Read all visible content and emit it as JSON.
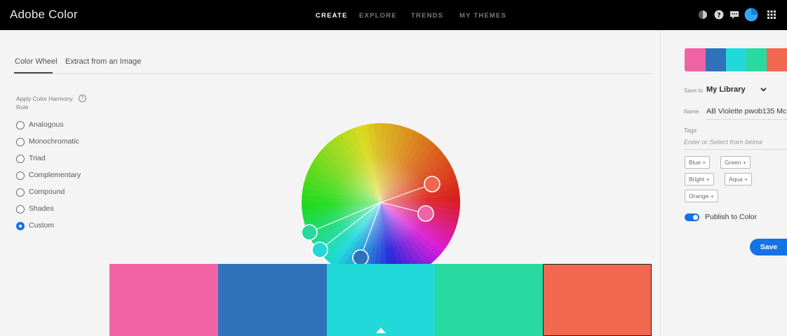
{
  "app": {
    "title": "Adobe Color"
  },
  "nav": [
    {
      "label": "CREATE",
      "active": true
    },
    {
      "label": "EXPLORE",
      "active": false
    },
    {
      "label": "TRENDS",
      "active": false
    },
    {
      "label": "MY THEMES",
      "active": false
    }
  ],
  "top_icons": [
    "moon-toggle-icon",
    "help-icon",
    "chat-icon",
    "user-avatar-icon",
    "apps-grid-icon"
  ],
  "tabs": [
    {
      "label": "Color Wheel",
      "active": true
    },
    {
      "label": "Extract from an Image",
      "active": false
    }
  ],
  "harmony": {
    "label": "Apply Color Harmony Rule",
    "options": [
      {
        "label": "Analogous",
        "checked": false
      },
      {
        "label": "Monochromatic",
        "checked": false
      },
      {
        "label": "Triad",
        "checked": false
      },
      {
        "label": "Complementary",
        "checked": false
      },
      {
        "label": "Compound",
        "checked": false
      },
      {
        "label": "Shades",
        "checked": false
      },
      {
        "label": "Custom",
        "checked": true
      }
    ]
  },
  "swatches": [
    "#f063a4",
    "#2f72ba",
    "#22d9da",
    "#28d9a0",
    "#f2674f"
  ],
  "panel": {
    "save_to_label": "Save to",
    "library": "My Library",
    "name_label": "Name",
    "name_value": "AB Violette pwob135 Mc...",
    "tags_label": "Tags",
    "tags_placeholder": "Enter or Select from below",
    "tags": [
      "Blue",
      "Green",
      "Bright",
      "Aqua",
      "Orange"
    ],
    "publish_label": "Publish to Color",
    "publish_on": true,
    "save_label": "Save"
  }
}
